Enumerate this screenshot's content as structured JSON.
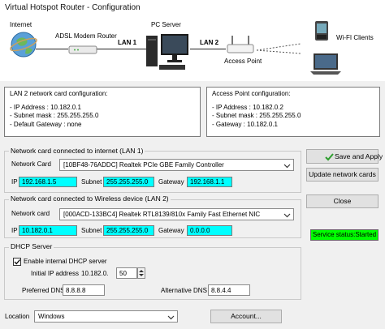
{
  "window": {
    "title": "Virtual Hotspot Router - Configuration"
  },
  "diagram": {
    "internet": "Internet",
    "modem": "ADSL Modem Router",
    "lan1": "LAN 1",
    "pc_server": "PC Server",
    "lan2": "LAN 2",
    "access_point": "Access Point",
    "wifi_clients": "Wi-FI Clients"
  },
  "lan2_config": {
    "title": "LAN 2 network card configuration:",
    "lines": [
      "- IP Address : 10.182.0.1",
      "- Subnet mask : 255.255.255.0",
      "- Default Gateway : none"
    ]
  },
  "ap_config": {
    "title": "Access Point configuration:",
    "lines": [
      "- IP Address : 10.182.0.2",
      "- Subnet mask : 255.255.255.0",
      "- Gateway : 10.182.0.1"
    ]
  },
  "lan1_group": {
    "label": "Network card connected to internet (LAN 1)",
    "card_label": "Network Card",
    "card_value": "[10BF48-76ADDC] Realtek PCIe GBE Family Controller",
    "ip_label": "IP",
    "ip": "192.168.1.5",
    "subnet_label": "Subnet",
    "subnet": "255.255.255.0",
    "gateway_label": "Gateway",
    "gateway": "192.168.1.1"
  },
  "lan2_group": {
    "label": "Network card connected to Wireless device (LAN 2)",
    "card_label": "Network card",
    "card_value": "[000ACD-133BC4] Realtek RTL8139/810x Family Fast Ethernet NIC",
    "ip_label": "IP",
    "ip": "10.182.0.1",
    "subnet_label": "Subnet",
    "subnet": "255.255.255.0",
    "gateway_label": "Gateway",
    "gateway": "0.0.0.0"
  },
  "dhcp": {
    "label": "DHCP Server",
    "enable_label": "Enable internal DHCP server",
    "enabled": true,
    "initial_ip_label": "Initial IP address",
    "initial_ip_prefix": "10.182.0.",
    "initial_ip_last": "50",
    "preferred_dns_label": "Preferred DNS",
    "preferred_dns": "8.8.8.8",
    "alternative_dns_label": "Alternative DNS",
    "alternative_dns": "8.8.4.4"
  },
  "buttons": {
    "save": "Save and Apply",
    "update": "Update network cards",
    "close": "Close",
    "account": "Account..."
  },
  "status": {
    "text": "Service status:Started",
    "color": "#00ff00"
  },
  "location": {
    "label": "Location",
    "value": "Windows"
  },
  "colors": {
    "ip_field": "#00ffff",
    "save_check": "#2e9e2e"
  }
}
